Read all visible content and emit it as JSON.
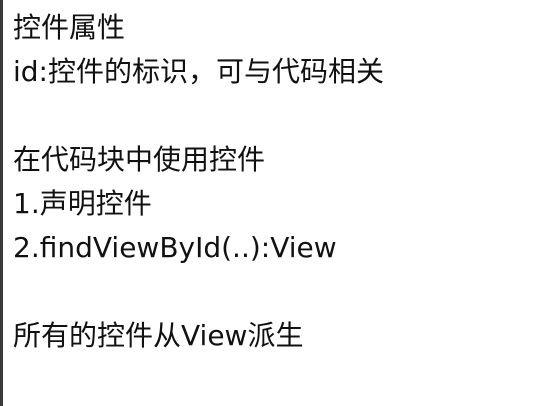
{
  "notes": {
    "line1": "控件属性",
    "line2": "id:控件的标识，可与代码相关",
    "line3": "在代码块中使用控件",
    "line4": "1.声明控件",
    "line5": "2.findViewById(..):View",
    "line6": "所有的控件从View派生"
  },
  "colors": {
    "text": "#111111",
    "background": "#ffffff",
    "edge": "#3a3a3a"
  }
}
